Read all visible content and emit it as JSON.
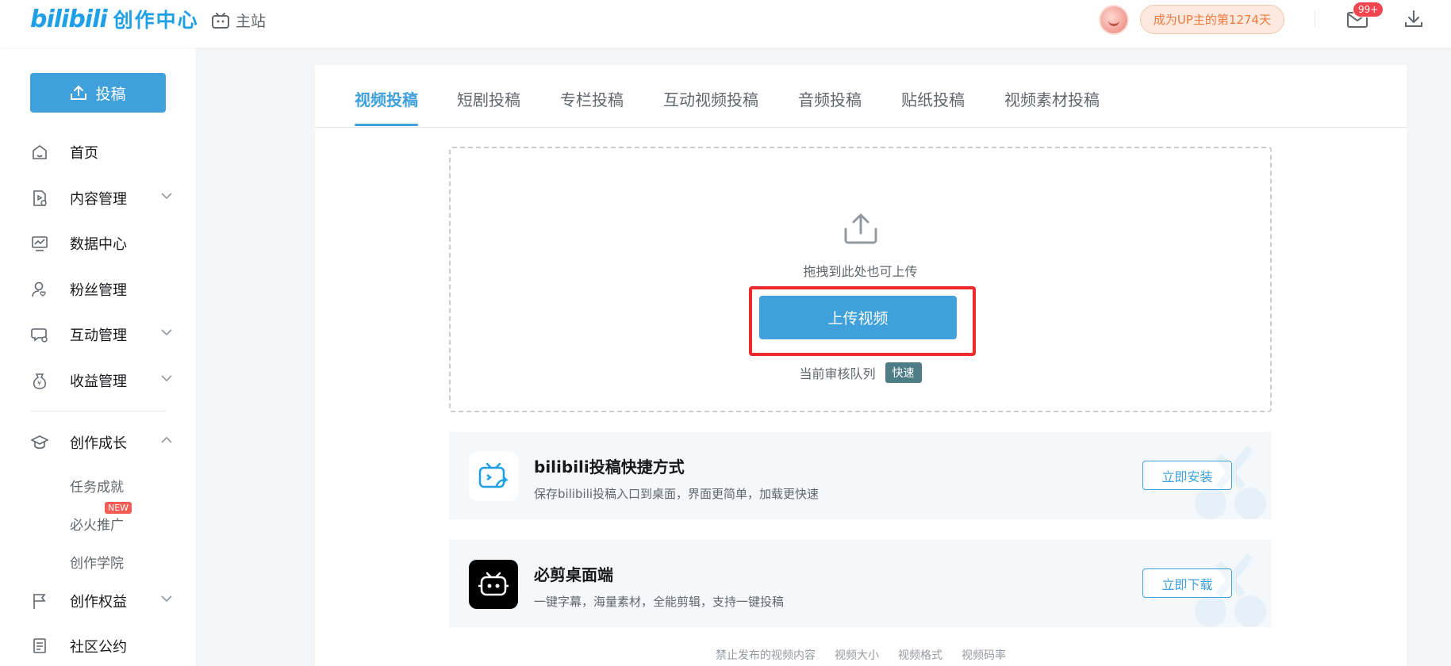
{
  "header": {
    "logo": "bilibili",
    "logo_sub": "创作中心",
    "home_label": "主站",
    "creator_days": "成为UP主的第1274天",
    "mail_badge": "99+"
  },
  "sidebar": {
    "upload_label": "投稿",
    "items": [
      {
        "label": "首页",
        "icon": "home-icon"
      },
      {
        "label": "内容管理",
        "icon": "content-icon",
        "expandable": true
      },
      {
        "label": "数据中心",
        "icon": "chart-icon"
      },
      {
        "label": "粉丝管理",
        "icon": "fans-icon"
      },
      {
        "label": "互动管理",
        "icon": "interaction-icon",
        "expandable": true
      },
      {
        "label": "收益管理",
        "icon": "income-icon",
        "expandable": true
      },
      {
        "label": "创作成长",
        "icon": "growth-icon",
        "expanded": true
      },
      {
        "label": "创作权益",
        "icon": "flag-icon",
        "expandable": true
      },
      {
        "label": "社区公约",
        "icon": "rules-icon"
      }
    ],
    "sub_items": [
      "任务成就",
      "必火推广",
      "创作学院"
    ],
    "new_tag": "NEW"
  },
  "tabs": [
    "视频投稿",
    "短剧投稿",
    "专栏投稿",
    "互动视频投稿",
    "音频投稿",
    "贴纸投稿",
    "视频素材投稿"
  ],
  "upload": {
    "hint": "拖拽到此处也可上传",
    "button": "上传视频",
    "queue_label": "当前审核队列",
    "queue_status": "快速"
  },
  "promos": [
    {
      "title": "bilibili投稿快捷方式",
      "desc": "保存bilibili投稿入口到桌面，界面更简单，加载更快速",
      "button": "立即安装"
    },
    {
      "title": "必剪桌面端",
      "desc": "一键字幕，海量素材，全能剪辑，支持一键投稿",
      "button": "立即下载"
    }
  ],
  "footer_links": [
    "禁止发布的视频内容",
    "视频大小",
    "视频格式",
    "视频码率"
  ],
  "colors": {
    "accent": "#3fa0dc",
    "highlight_frame": "#ee2a2a",
    "queue_tag": "#4f7d87"
  }
}
